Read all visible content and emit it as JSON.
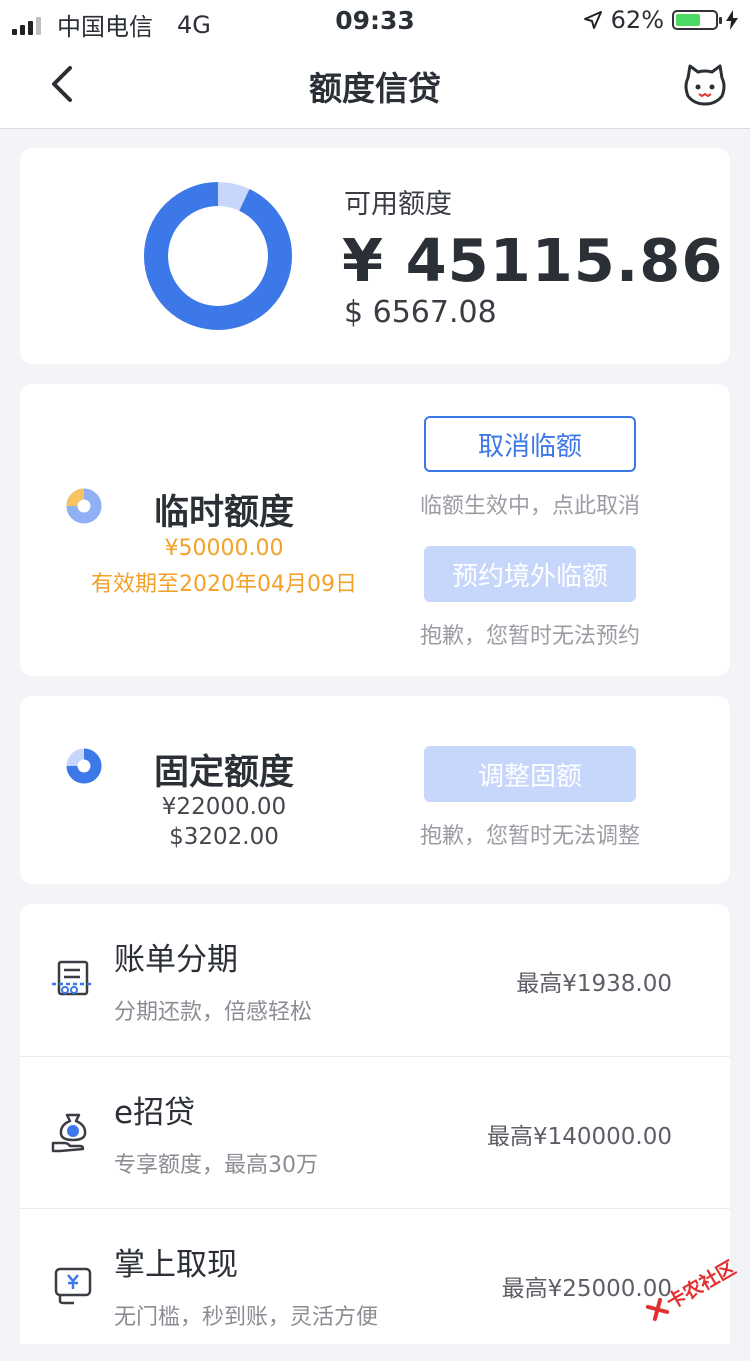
{
  "status": {
    "carrier": "中国电信",
    "network": "4G",
    "time": "09:33",
    "battery_text": "62%",
    "battery_level": 0.62,
    "battery_color": "#4cd964"
  },
  "header": {
    "title": "额度信贷",
    "back_icon": "chevron-left-icon",
    "right_icon": "cat-mascot-icon"
  },
  "available": {
    "label": "可用额度",
    "cny": "¥ 45115.86",
    "usd": "$ 6567.08",
    "ring_fraction": 0.93,
    "ring_color": "#3d78e8",
    "ring_track_color": "#c7d7fb"
  },
  "temporary": {
    "title": "临时额度",
    "amount": "¥50000.00",
    "validity": "有效期至2020年04月09日",
    "cancel_button": "取消临额",
    "cancel_hint": "临额生效中，点此取消",
    "reserve_button": "预约境外临额",
    "reserve_hint": "抱歉，您暂时无法预约"
  },
  "fixed": {
    "title": "固定额度",
    "cny": "¥22000.00",
    "usd": "$3202.00",
    "adjust_button": "调整固额",
    "adjust_hint": "抱歉，您暂时无法调整"
  },
  "services": [
    {
      "name": "账单分期",
      "desc": "分期还款，倍感轻松",
      "max": "最高¥1938.00",
      "icon": "bill-installment-icon"
    },
    {
      "name": "e招贷",
      "desc": "专享额度，最高30万",
      "max": "最高¥140000.00",
      "icon": "money-bag-hand-icon"
    },
    {
      "name": "掌上取现",
      "desc": "无门槛，秒到账，灵活方便",
      "max": "最高¥25000.00",
      "icon": "cash-withdraw-icon"
    }
  ],
  "watermark": "卡农社区",
  "colors": {
    "accent": "#3d78e8",
    "orange": "#f2a12a",
    "disabled_button": "#c7d7fb"
  }
}
